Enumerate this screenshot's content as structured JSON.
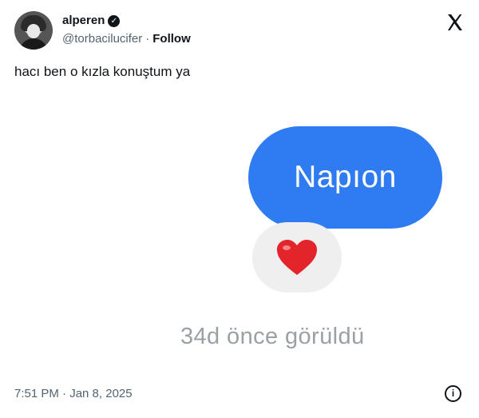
{
  "author": {
    "name": "alperen",
    "handle": "@torbacilucifer",
    "separator": "·",
    "follow_label": "Follow",
    "verified_icon": "verified-badge-icon"
  },
  "brand": {
    "icon": "x-logo-icon"
  },
  "tweet": {
    "text": "hacı ben o kızla konuştum ya",
    "timestamp": "7:51 PM · Jan 8, 2025"
  },
  "media": {
    "message_bubble": "Napıon",
    "reaction_icon": "heart-icon",
    "seen_status": "34d önce görüldü"
  },
  "colors": {
    "bubble_blue": "#2f7bf1",
    "heart_red": "#e3242b",
    "text_primary": "#0f1419",
    "text_secondary": "#536471"
  }
}
